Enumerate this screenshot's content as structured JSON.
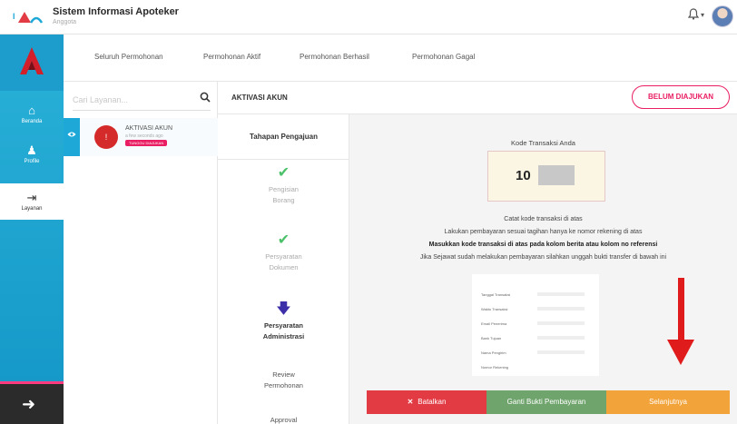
{
  "header": {
    "logo_text": "IAI",
    "title": "Sistem Informasi Apoteker",
    "subtitle": "Anggota",
    "bell_icon": "bell-icon",
    "caret": "▾"
  },
  "rail": {
    "logo_icon": "brand-a-icon",
    "items": [
      {
        "label": "Beranda",
        "icon": "home-icon",
        "glyph": "⌂"
      },
      {
        "label": "Profile",
        "icon": "person-icon",
        "glyph": "♟"
      },
      {
        "label": "Layanan",
        "icon": "login-icon",
        "glyph": "⇥"
      }
    ],
    "logout_glyph": "➜"
  },
  "tabs": [
    "Seluruh Permohonan",
    "Permohonan Aktif",
    "Permohonan Berhasil",
    "Permohonan Gagal"
  ],
  "search": {
    "placeholder": "Cari Layanan..."
  },
  "list": {
    "item_title": "AKTIVASI AKUN",
    "item_time": "a few seconds ago",
    "item_badge": "TUNGGU DIAJUKAN",
    "avatar_letter": "!"
  },
  "detail": {
    "title": "AKTIVASI AKUN",
    "status": "BELUM DIAJUKAN"
  },
  "steps": {
    "header": "Tahapan Pengajuan",
    "items": [
      {
        "line1": "Pengisian",
        "line2": "Borang",
        "state": "done"
      },
      {
        "line1": "Persyaratan",
        "line2": "Dokumen",
        "state": "done"
      },
      {
        "line1": "Persyaratan",
        "line2": "Administrasi",
        "state": "current"
      },
      {
        "line1": "Review",
        "line2": "Permohonan",
        "state": "pending"
      },
      {
        "line1": "Approval",
        "line2": "",
        "state": "pending"
      }
    ]
  },
  "content": {
    "code_label": "Kode Transaksi Anda",
    "code_value": "10",
    "inst1": "Catat kode transaksi di atas",
    "inst2": "Lakukan pembayaran sesuai tagihan hanya ke nomor rekening di atas",
    "inst3": "Masukkan kode transaksi di atas pada kolom berita atau kolom no referensi",
    "inst4": "Jika Sejawat sudah melakukan pembayaran silahkan unggah bukti transfer di bawah ini",
    "proof_lines": [
      "Tanggal Transaksi",
      "Waktu Transaksi",
      "Email Penerima",
      "Bank Tujuan",
      "Nama Pengirim",
      "Nomor Rekening"
    ]
  },
  "actions": {
    "cancel": "Batalkan",
    "change": "Ganti Bukti Pembayaran",
    "next": "Selanjutnya"
  },
  "colors": {
    "accent": "#1ea8d8",
    "danger": "#e23b44",
    "success": "#6fa46c",
    "warning": "#f2a33a",
    "badge": "#e91e63"
  }
}
